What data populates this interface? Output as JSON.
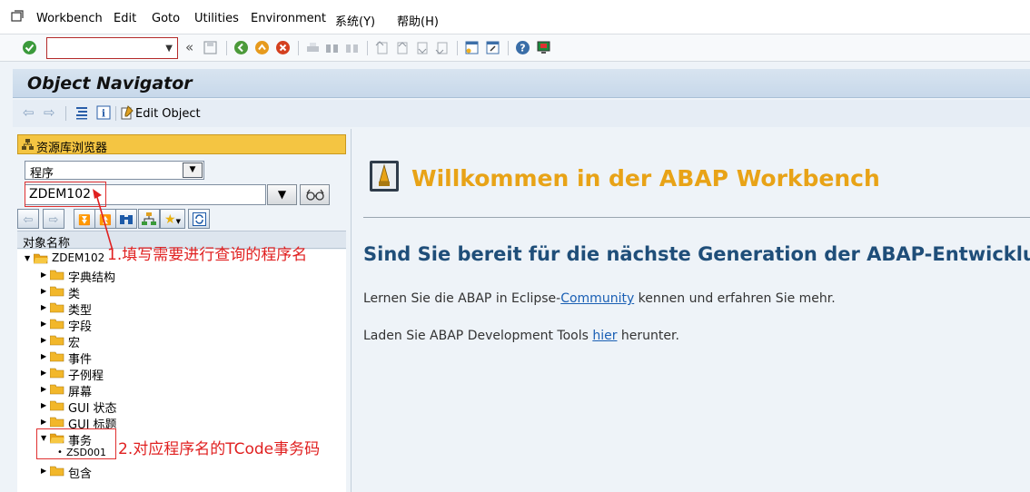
{
  "menu": {
    "items": [
      "Workbench",
      "Edit",
      "Goto",
      "Utilities",
      "Environment",
      "系统(Y)",
      "帮助(H)"
    ]
  },
  "toolbar": {
    "command_value": ""
  },
  "title": "Object Navigator",
  "app_toolbar": {
    "edit_object": "Edit Object"
  },
  "repository_browser": {
    "header": "资源库浏览器",
    "type_select": "程序",
    "name_value": "ZDEM102",
    "tree_header": "对象名称",
    "root": "ZDEM102",
    "nodes": [
      "字典结构",
      "类",
      "类型",
      "字段",
      "宏",
      "事件",
      "子例程",
      "屏幕",
      "GUI 状态",
      "GUI 标题",
      "事务",
      "包含"
    ],
    "transaction_child": "ZSD001"
  },
  "annotations": {
    "step1": "1.填写需要进行查询的程序名",
    "step2": "2.对应程序名的TCode事务码"
  },
  "welcome": {
    "title": "Willkommen in der ABAP Workbench",
    "heading": "Sind Sie bereit für die nächste Generation der ABAP-Entwicklung?",
    "line1_before": "Lernen Sie die ABAP in Eclipse-",
    "line1_link": "Community",
    "line1_after": " kennen und erfahren Sie mehr.",
    "line2_before": "Laden Sie ABAP Development Tools ",
    "line2_link": "hier",
    "line2_after": " herunter."
  },
  "colors": {
    "welcome_title": "#e8a317",
    "heading": "#1f4e79",
    "annotation": "#e02020",
    "browser_header": "#f4c542"
  }
}
